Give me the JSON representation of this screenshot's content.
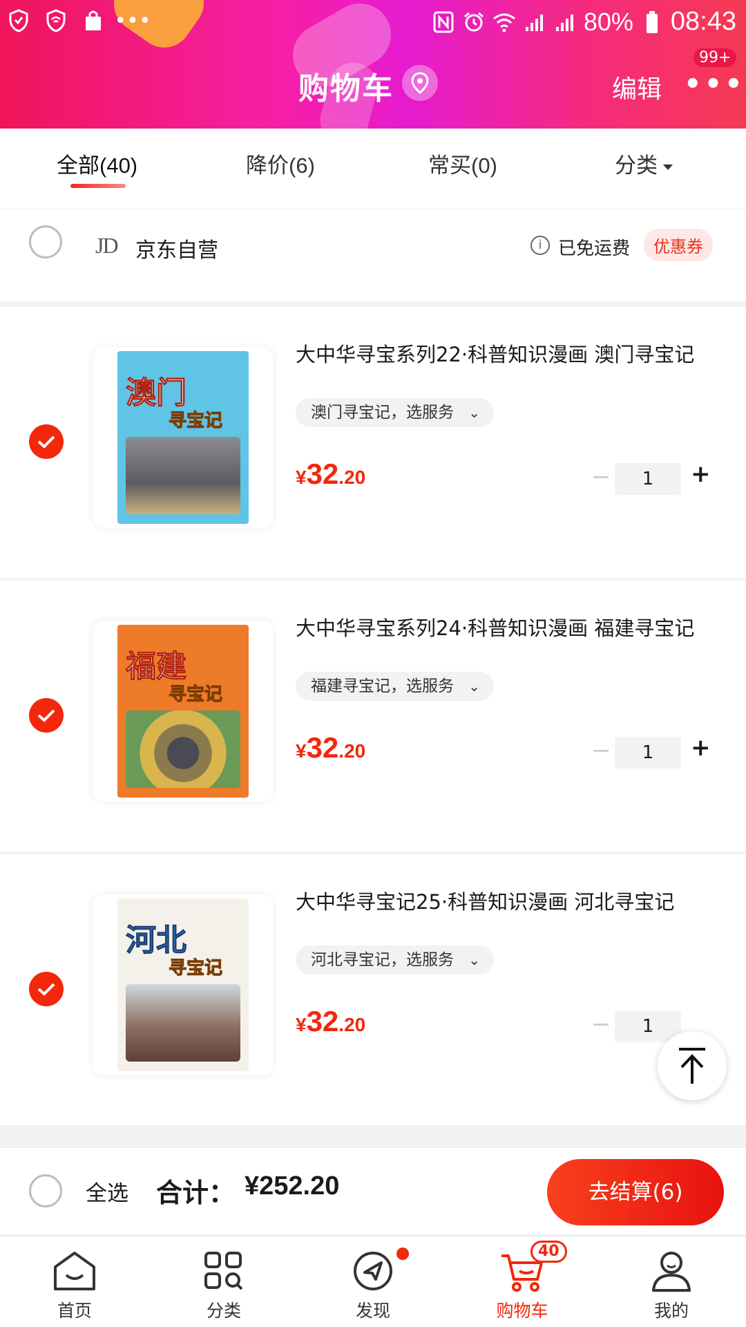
{
  "status_bar": {
    "time": "08:43",
    "battery": "80%",
    "left_icons": [
      "shield-icon",
      "wifi-shield-icon",
      "bag-icon",
      "more-dots-icon"
    ],
    "right_icons": [
      "nfc-icon",
      "alarm-icon",
      "wifi-icon",
      "signal-icon",
      "signal-4g-icon",
      "battery-icon"
    ]
  },
  "header": {
    "title": "购物车",
    "edit_label": "编辑",
    "more_badge": "99+"
  },
  "tabs": [
    {
      "label": "全部(40)",
      "active": true
    },
    {
      "label": "降价(6)",
      "active": false
    },
    {
      "label": "常买(0)",
      "active": false
    },
    {
      "label": "分类",
      "active": false
    }
  ],
  "shop": {
    "logo": "JD",
    "name": "京东自营",
    "shipping": "已免运费",
    "coupon": "优惠券"
  },
  "items": [
    {
      "title": "大中华寻宝系列22·科普知识漫画 澳门寻宝记",
      "cover_title": "澳门",
      "cover_subtitle": "寻宝记",
      "variant": "澳门寻宝记，选服务",
      "price_currency": "¥",
      "price_int": "32",
      "price_dec": ".20",
      "qty": "1",
      "checked": true
    },
    {
      "title": "大中华寻宝系列24·科普知识漫画 福建寻宝记",
      "cover_title": "福建",
      "cover_subtitle": "寻宝记",
      "variant": "福建寻宝记，选服务",
      "price_currency": "¥",
      "price_int": "32",
      "price_dec": ".20",
      "qty": "1",
      "checked": true
    },
    {
      "title": "大中华寻宝记25·科普知识漫画 河北寻宝记",
      "cover_title": "河北",
      "cover_subtitle": "寻宝记",
      "variant": "河北寻宝记，选服务",
      "price_currency": "¥",
      "price_int": "32",
      "price_dec": ".20",
      "qty": "1",
      "checked": true
    }
  ],
  "checkout": {
    "select_all": "全选",
    "total_label": "合计：",
    "total_value": "¥252.20",
    "button": "去结算(6)"
  },
  "bottom_nav": [
    {
      "label": "首页",
      "icon": "home-icon",
      "active": false
    },
    {
      "label": "分类",
      "icon": "category-icon",
      "active": false
    },
    {
      "label": "发现",
      "icon": "discover-icon",
      "active": false,
      "dot": true
    },
    {
      "label": "购物车",
      "icon": "cart-icon",
      "active": true,
      "badge": "40"
    },
    {
      "label": "我的",
      "icon": "profile-icon",
      "active": false
    }
  ],
  "colors": {
    "accent": "#f2270c",
    "header_gradient": [
      "#f0155a",
      "#e51bd0",
      "#f53a52"
    ]
  }
}
